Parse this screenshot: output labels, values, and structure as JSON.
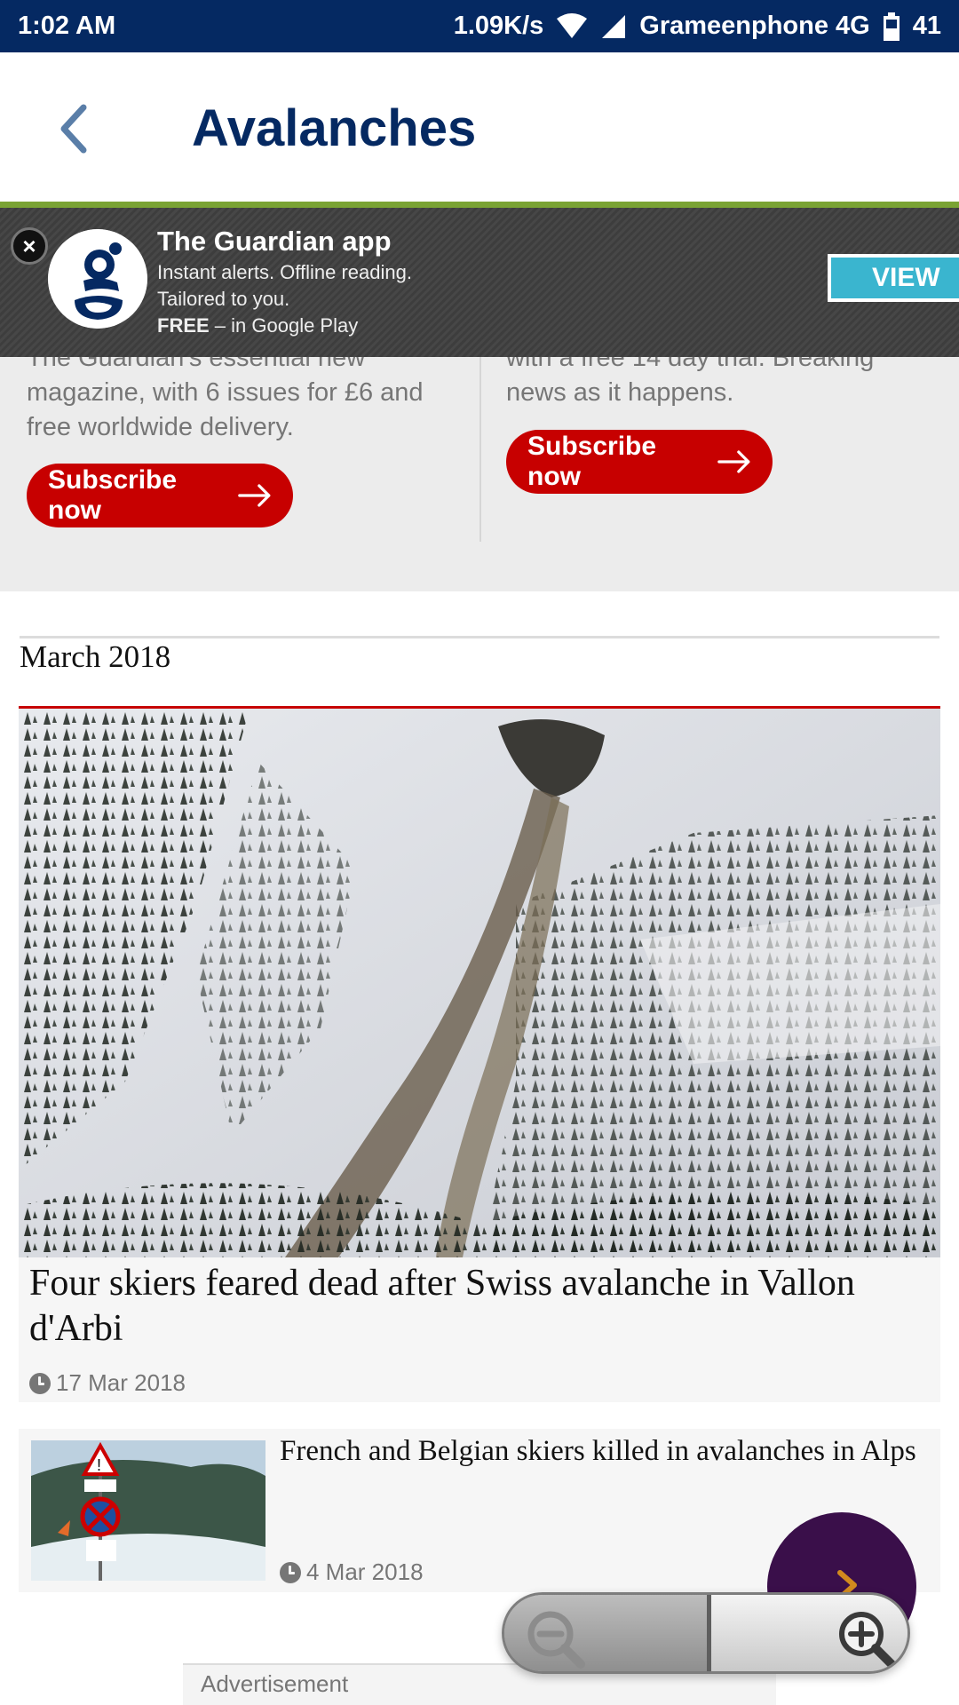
{
  "status_bar": {
    "time": "1:02 AM",
    "speed": "1.09K/s",
    "carrier": "Grameenphone 4G",
    "battery": "41"
  },
  "app_bar": {
    "title": "Avalanches",
    "back_icon": "chevron-left-icon"
  },
  "app_banner": {
    "title": "The Guardian app",
    "line1": "Instant alerts. Offline reading.",
    "line2": "Tailored to you.",
    "free_label": "FREE",
    "store_text": " – in Google Play",
    "view_label": "VIEW",
    "close_label": "×"
  },
  "subscribe": {
    "col1_partial": "The Guardian's essential new",
    "col1_text": "magazine, with 6 issues for £6 and free worldwide delivery.",
    "col2_partial": "with a free 14 day trial. Breaking",
    "col2_text": "news as it happens.",
    "button_label": "Subscribe now"
  },
  "section": {
    "month": "March 2018"
  },
  "articles": [
    {
      "headline": "Four skiers feared dead after Swiss avalanche in Vallon d'Arbi",
      "date": "17 Mar 2018"
    },
    {
      "headline": "French and Belgian skiers killed in avalanches in Alps",
      "date": "4 Mar 2018"
    }
  ],
  "ad": {
    "label": "Advertisement"
  },
  "colors": {
    "guardian_navy": "#052962",
    "subscribe_red": "#c70000",
    "banner_green": "#7aa334",
    "view_teal": "#3ab5cf"
  }
}
